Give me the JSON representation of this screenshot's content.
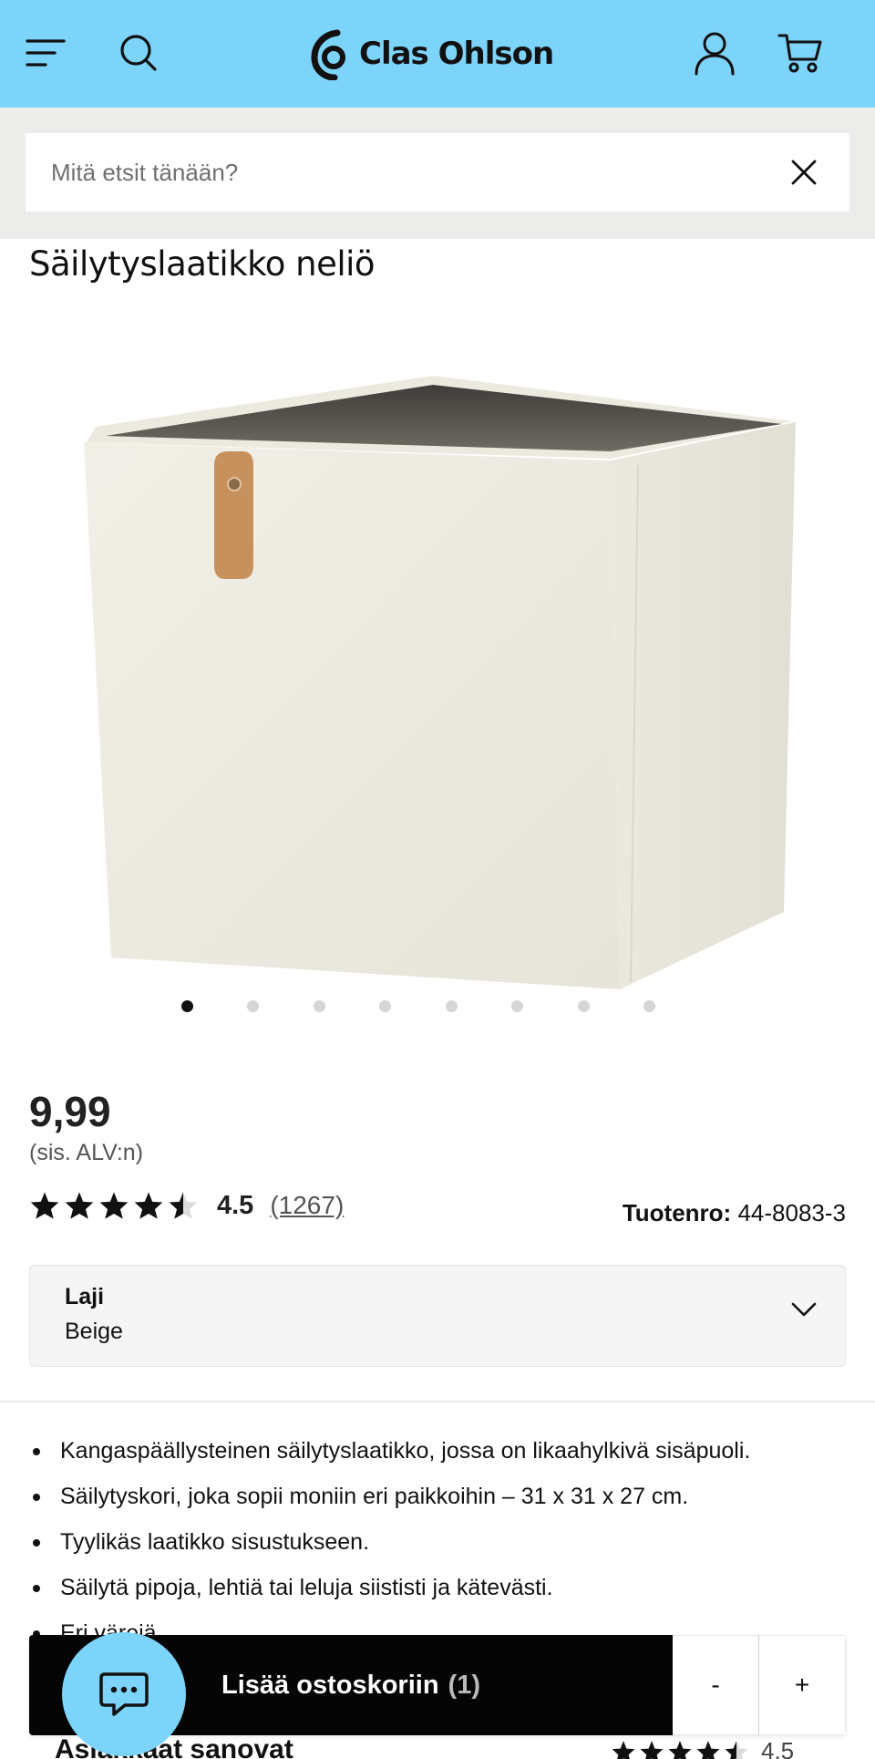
{
  "header": {
    "brand": "Clas Ohlson",
    "icons": [
      "menu-icon",
      "search-icon",
      "account-icon",
      "cart-icon"
    ],
    "brand_color": "#7dd4fb"
  },
  "search": {
    "placeholder": "Mitä etsit tänään?",
    "value": ""
  },
  "product": {
    "title": "Säilytyslaatikko neliö",
    "image_count": 8,
    "active_image": 1,
    "price": "9,99",
    "vat_note": "(sis. ALV:n)",
    "rating": {
      "value": "4.5",
      "stars": 4.5,
      "count": "(1267)"
    },
    "sku_label": "Tuotenro:",
    "sku": "44-8083-3",
    "variant": {
      "label": "Laji",
      "value": "Beige"
    },
    "bullets": [
      "Kangaspäällysteinen säilytyslaatikko, jossa on likaahylkivä sisäpuoli.",
      "Säilytyskori, joka sopii moniin eri paikkoihin – 31 x 31 x 27 cm.",
      "Tyylikäs laatikko sisustukseen.",
      "Säilytä pipoja, lehtiä tai leluja siististi ja kätevästi.",
      "Eri värejä."
    ]
  },
  "reviews": {
    "heading": "Asiakkaat sanovat",
    "value": "4.5"
  },
  "cartbar": {
    "add_label": "Lisää ostoskoriin",
    "quantity": "(1)",
    "minus": "-",
    "plus": "+"
  },
  "chat": {
    "icon": "chat-icon"
  }
}
